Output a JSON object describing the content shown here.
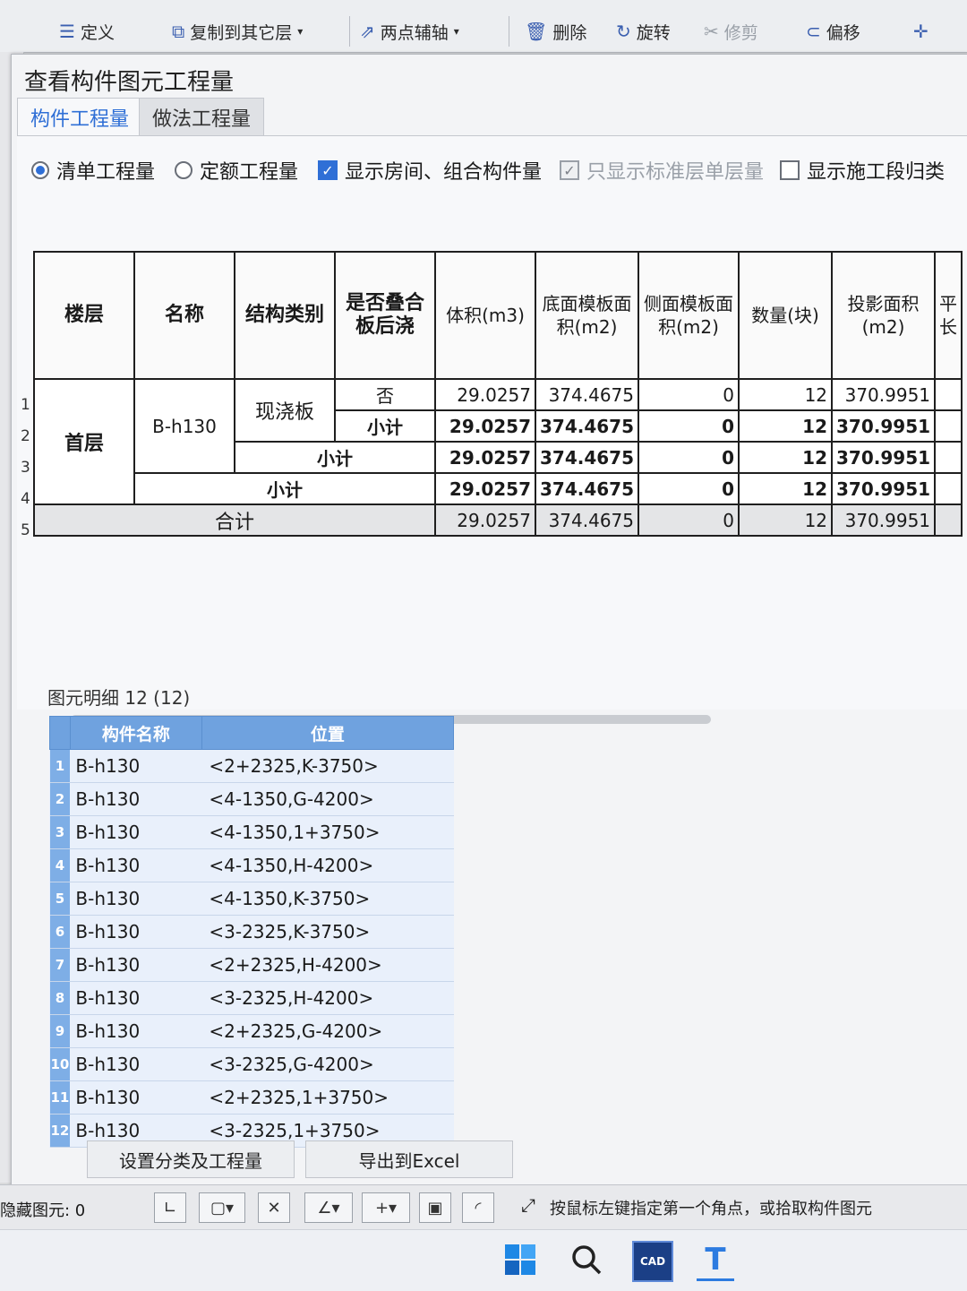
{
  "toolbar": {
    "items": [
      {
        "label": "定义",
        "icon": "define-icon"
      },
      {
        "label": "复制到其它层",
        "icon": "copy-layer-icon"
      },
      {
        "label": "两点辅轴",
        "icon": "axis-icon"
      },
      {
        "label": "删除",
        "icon": "delete-icon"
      },
      {
        "label": "旋转",
        "icon": "rotate-icon"
      },
      {
        "label": "修剪",
        "icon": "trim-icon"
      },
      {
        "label": "偏移",
        "icon": "offset-icon"
      }
    ]
  },
  "dialog": {
    "title": "查看构件图元工程量",
    "tabs": [
      "构件工程量",
      "做法工程量"
    ],
    "options": {
      "radio1": "清单工程量",
      "radio2": "定额工程量",
      "check1": "显示房间、组合构件量",
      "check2": "只显示标准层单层量",
      "check3": "显示施工段归类"
    }
  },
  "quantity_table": {
    "headers": [
      "楼层",
      "名称",
      "结构类别",
      "是否叠合板后浇",
      "体积(m3)",
      "底面模板面积(m2)",
      "侧面模板面积(m2)",
      "数量(块)",
      "投影面积(m2)",
      "平长"
    ],
    "row_numbers": [
      "1",
      "2",
      "3",
      "4",
      "5"
    ],
    "floor": "首层",
    "name": "B-h130",
    "struct": "现浇板",
    "rows": [
      {
        "label": "否",
        "volume": "29.0257",
        "bottom": "374.4675",
        "side": "0",
        "count": "12",
        "proj": "370.9951"
      },
      {
        "label": "小计",
        "volume": "29.0257",
        "bottom": "374.4675",
        "side": "0",
        "count": "12",
        "proj": "370.9951"
      },
      {
        "label": "小计",
        "volume": "29.0257",
        "bottom": "374.4675",
        "side": "0",
        "count": "12",
        "proj": "370.9951"
      },
      {
        "label": "小计",
        "volume": "29.0257",
        "bottom": "374.4675",
        "side": "0",
        "count": "12",
        "proj": "370.9951"
      },
      {
        "label": "合计",
        "volume": "29.0257",
        "bottom": "374.4675",
        "side": "0",
        "count": "12",
        "proj": "370.9951"
      }
    ]
  },
  "detail": {
    "title": "图元明细  12 (12)",
    "headers": [
      "构件名称",
      "位置"
    ],
    "rows": [
      {
        "idx": "1",
        "name": "B-h130",
        "pos": "<2+2325,K-3750>"
      },
      {
        "idx": "2",
        "name": "B-h130",
        "pos": "<4-1350,G-4200>"
      },
      {
        "idx": "3",
        "name": "B-h130",
        "pos": "<4-1350,1+3750>"
      },
      {
        "idx": "4",
        "name": "B-h130",
        "pos": "<4-1350,H-4200>"
      },
      {
        "idx": "5",
        "name": "B-h130",
        "pos": "<4-1350,K-3750>"
      },
      {
        "idx": "6",
        "name": "B-h130",
        "pos": "<3-2325,K-3750>"
      },
      {
        "idx": "7",
        "name": "B-h130",
        "pos": "<2+2325,H-4200>"
      },
      {
        "idx": "8",
        "name": "B-h130",
        "pos": "<3-2325,H-4200>"
      },
      {
        "idx": "9",
        "name": "B-h130",
        "pos": "<2+2325,G-4200>"
      },
      {
        "idx": "10",
        "name": "B-h130",
        "pos": "<3-2325,G-4200>"
      },
      {
        "idx": "11",
        "name": "B-h130",
        "pos": "<2+2325,1+3750>"
      },
      {
        "idx": "12",
        "name": "B-h130",
        "pos": "<3-2325,1+3750>"
      }
    ],
    "buttons": [
      "设置分类及工程量",
      "导出到Excel"
    ]
  },
  "statusbar": {
    "hidden_label": "隐藏图元: 0",
    "hint": "按鼠标左键指定第一个角点，或拾取构件图元"
  },
  "taskbar": {
    "icons": [
      "windows-start-icon",
      "search-icon",
      "cad-app-icon",
      "text-app-icon"
    ],
    "cad_label": "CAD"
  },
  "colors": {
    "accent": "#2f6fd6",
    "grid_header": "#6fa2df"
  }
}
